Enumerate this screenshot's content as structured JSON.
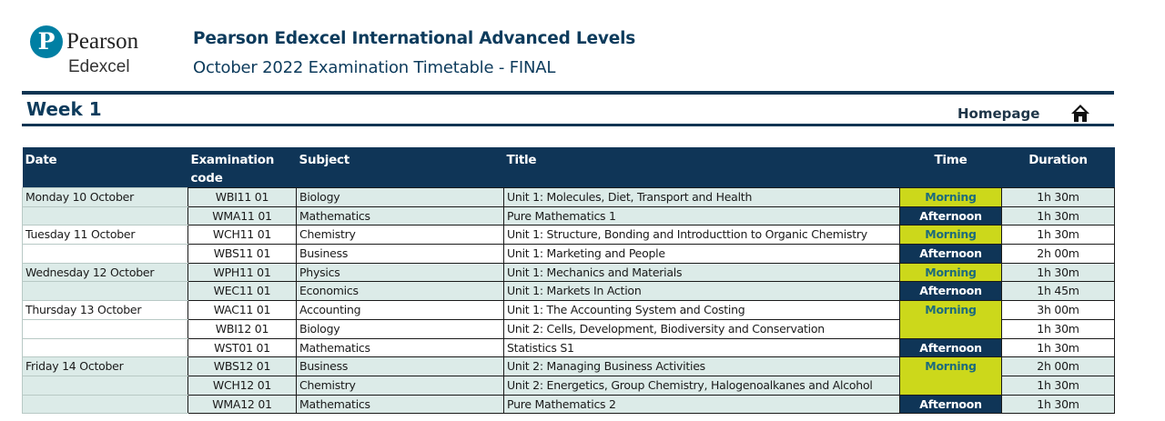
{
  "header": {
    "logo_pearson": "Pearson",
    "logo_edexcel": "Edexcel",
    "title": "Pearson Edexcel International Advanced Levels",
    "subtitle": "October 2022 Examination Timetable - FINAL"
  },
  "week_label": "Week 1",
  "homepage_label": "Homepage",
  "colors": {
    "navy": "#0f3557",
    "morning": "#ccd81b",
    "afternoon": "#0f3557",
    "row_alt": "#dcebe8"
  },
  "table": {
    "columns": {
      "date": "Date",
      "code_line1": "Examination",
      "code_line2": "code",
      "subject": "Subject",
      "title": "Title",
      "time": "Time",
      "duration": "Duration"
    },
    "rows": [
      {
        "date": "Monday 10 October",
        "code": "WBI11 01",
        "subject": "Biology",
        "title": "Unit 1: Molecules, Diet, Transport and Health",
        "time": "Morning",
        "duration": "1h 30m"
      },
      {
        "date": "",
        "code": "WMA11 01",
        "subject": "Mathematics",
        "title": "Pure Mathematics 1",
        "time": "Afternoon",
        "duration": "1h 30m"
      },
      {
        "date": "Tuesday 11 October",
        "code": "WCH11 01",
        "subject": "Chemistry",
        "title": "Unit 1: Structure, Bonding and Introducttion to Organic Chemistry",
        "time": "Morning",
        "duration": "1h 30m"
      },
      {
        "date": "",
        "code": "WBS11 01",
        "subject": "Business",
        "title": "Unit 1: Marketing and People",
        "time": "Afternoon",
        "duration": "2h 00m"
      },
      {
        "date": "Wednesday 12 October",
        "code": "WPH11 01",
        "subject": "Physics",
        "title": "Unit 1: Mechanics and Materials",
        "time": "Morning",
        "duration": "1h 30m"
      },
      {
        "date": "",
        "code": "WEC11 01",
        "subject": "Economics",
        "title": "Unit 1: Markets In Action",
        "time": "Afternoon",
        "duration": "1h 45m"
      },
      {
        "date": "Thursday 13 October",
        "code": "WAC11 01",
        "subject": "Accounting",
        "title": "Unit 1: The Accounting System and Costing",
        "time": "Morning",
        "duration": "3h 00m"
      },
      {
        "date": "",
        "code": "WBI12 01",
        "subject": "Biology",
        "title": "Unit 2: Cells, Development, Biodiversity and Conservation",
        "time": "",
        "duration": "1h 30m"
      },
      {
        "date": "",
        "code": "WST01 01",
        "subject": "Mathematics",
        "title": "Statistics S1",
        "time": "Afternoon",
        "duration": "1h 30m"
      },
      {
        "date": "Friday 14 October",
        "code": "WBS12 01",
        "subject": "Business",
        "title": "Unit 2: Managing Business Activities",
        "time": "Morning",
        "duration": "2h 00m"
      },
      {
        "date": "",
        "code": "WCH12 01",
        "subject": "Chemistry",
        "title": "Unit 2: Energetics, Group Chemistry, Halogenoalkanes and Alcohol",
        "time": "",
        "duration": "1h 30m"
      },
      {
        "date": "",
        "code": "WMA12 01",
        "subject": "Mathematics",
        "title": "Pure Mathematics 2",
        "time": "Afternoon",
        "duration": "1h 30m"
      }
    ]
  }
}
